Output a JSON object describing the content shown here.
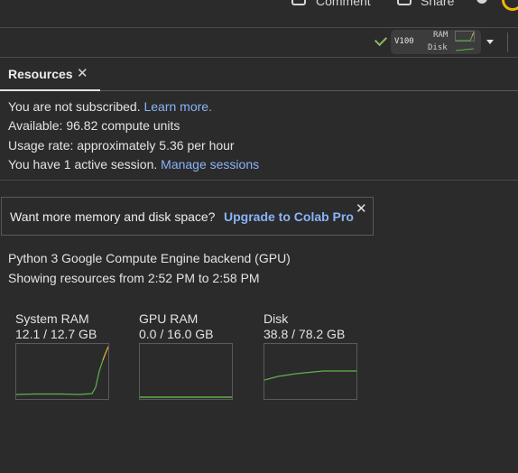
{
  "top_bar": {
    "comment_label": "Comment",
    "share_label": "Share"
  },
  "runtime": {
    "connected_icon": "check-icon",
    "gpu": "V100",
    "ram_label": "RAM",
    "disk_label": "Disk"
  },
  "tab": {
    "title": "Resources",
    "close": "✕"
  },
  "info": {
    "subscribe_text": "You are not subscribed.",
    "learn_more": "Learn more.",
    "available": "Available: 96.82 compute units",
    "usage": "Usage rate: approximately 5.36 per hour",
    "sessions_text": "You have 1 active session.",
    "manage_sessions": "Manage sessions"
  },
  "banner": {
    "text": "Want more memory and disk space?",
    "link": "Upgrade to Colab Pro",
    "close": "✕"
  },
  "backend": {
    "name": "Python 3 Google Compute Engine backend (GPU)",
    "range": "Showing resources from 2:52 PM to 2:58 PM"
  },
  "metrics": [
    {
      "name": "System RAM",
      "value": "12.1 / 12.7 GB"
    },
    {
      "name": "GPU RAM",
      "value": "0.0 / 16.0 GB"
    },
    {
      "name": "Disk",
      "value": "38.8 / 78.2 GB"
    }
  ],
  "colors": {
    "accent_link": "#8ab4f8",
    "graph_green": "#5fb24a",
    "graph_orange": "#e8a33b"
  }
}
